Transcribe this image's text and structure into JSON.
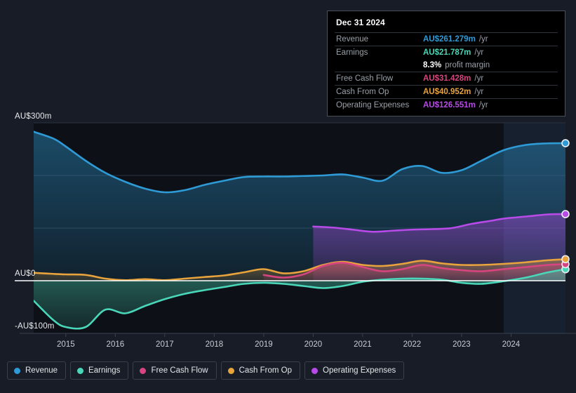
{
  "chart_data": {
    "type": "area",
    "title": "",
    "xlabel": "",
    "ylabel": "",
    "currency": "AU$",
    "ylim": [
      -100,
      300
    ],
    "xlim": [
      2014.35,
      2025.1
    ],
    "grid": true,
    "y_ticks": [
      {
        "value": 300,
        "label": "AU$300m"
      },
      {
        "value": 200,
        "label": ""
      },
      {
        "value": 100,
        "label": ""
      },
      {
        "value": 0,
        "label": "AU$0"
      },
      {
        "value": -100,
        "label": "-AU$100m"
      }
    ],
    "x_ticks": [
      2015,
      2016,
      2017,
      2018,
      2019,
      2020,
      2021,
      2022,
      2023,
      2024
    ],
    "x_tick_labels": [
      "2015",
      "2016",
      "2017",
      "2018",
      "2019",
      "2020",
      "2021",
      "2022",
      "2023",
      "2024"
    ],
    "forecast_band": {
      "start": 2023.85,
      "end": 2025.1,
      "label": ""
    },
    "legend_position": "bottom-left",
    "series": [
      {
        "name": "Revenue",
        "color": "#2e9bd6",
        "x": [
          2014.35,
          2014.75,
          2015.0,
          2015.4,
          2015.8,
          2016.2,
          2016.6,
          2017.0,
          2017.4,
          2017.8,
          2018.2,
          2018.6,
          2019.0,
          2019.4,
          2019.8,
          2020.2,
          2020.6,
          2021.0,
          2021.4,
          2021.8,
          2022.2,
          2022.6,
          2023.0,
          2023.4,
          2023.85,
          2024.3,
          2024.75,
          2025.1
        ],
        "values": [
          283,
          270,
          255,
          228,
          205,
          188,
          175,
          168,
          172,
          182,
          190,
          197,
          198,
          198,
          199,
          200,
          202,
          196,
          190,
          212,
          218,
          205,
          210,
          228,
          248,
          258,
          261,
          261.279
        ]
      },
      {
        "name": "Earnings",
        "color": "#4ad6b8",
        "x": [
          2014.35,
          2014.75,
          2015.0,
          2015.4,
          2015.8,
          2016.2,
          2016.6,
          2017.0,
          2017.4,
          2017.8,
          2018.2,
          2018.6,
          2019.0,
          2019.4,
          2019.8,
          2020.2,
          2020.6,
          2021.0,
          2021.4,
          2021.8,
          2022.2,
          2022.6,
          2023.0,
          2023.4,
          2023.85,
          2024.3,
          2024.75,
          2025.1
        ],
        "values": [
          -38,
          -75,
          -88,
          -88,
          -55,
          -62,
          -48,
          -35,
          -25,
          -18,
          -12,
          -6,
          -4,
          -6,
          -10,
          -14,
          -10,
          -2,
          2,
          4,
          4,
          2,
          -4,
          -6,
          -1,
          6,
          16,
          21.787
        ]
      },
      {
        "name": "Free Cash Flow",
        "color": "#d6457f",
        "x": [
          2019.0,
          2019.4,
          2019.8,
          2020.2,
          2020.6,
          2021.0,
          2021.4,
          2021.8,
          2022.2,
          2022.6,
          2023.0,
          2023.4,
          2023.85,
          2024.3,
          2024.75,
          2025.1
        ],
        "values": [
          11,
          6,
          12,
          28,
          34,
          26,
          18,
          22,
          30,
          24,
          20,
          18,
          22,
          26,
          30,
          31.428
        ]
      },
      {
        "name": "Cash From Op",
        "color": "#e8a33d",
        "x": [
          2014.35,
          2014.75,
          2015.0,
          2015.4,
          2015.8,
          2016.2,
          2016.6,
          2017.0,
          2017.4,
          2017.8,
          2018.2,
          2018.6,
          2019.0,
          2019.4,
          2019.8,
          2020.2,
          2020.6,
          2021.0,
          2021.4,
          2021.8,
          2022.2,
          2022.6,
          2023.0,
          2023.4,
          2023.85,
          2024.3,
          2024.75,
          2025.1
        ],
        "values": [
          15,
          13,
          12,
          11,
          4,
          1,
          3,
          1,
          4,
          7,
          10,
          16,
          22,
          14,
          18,
          30,
          36,
          30,
          28,
          32,
          38,
          33,
          30,
          30,
          32,
          35,
          39,
          40.952
        ]
      },
      {
        "name": "Operating Expenses",
        "color": "#b84ae8",
        "x": [
          2020.0,
          2020.4,
          2020.8,
          2021.2,
          2021.6,
          2022.0,
          2022.4,
          2022.8,
          2023.2,
          2023.6,
          2023.85,
          2024.3,
          2024.75,
          2025.1
        ],
        "values": [
          103,
          101,
          97,
          93,
          95,
          97,
          98,
          100,
          108,
          114,
          118,
          122,
          126,
          126.551
        ]
      }
    ]
  },
  "y_axis": {
    "top_label": "AU$300m",
    "zero_label": "AU$0",
    "bottom_label": "-AU$100m"
  },
  "tooltip": {
    "title": "Dec 31 2024",
    "rows": [
      {
        "label": "Revenue",
        "value": "AU$261.279m",
        "unit": "/yr",
        "color": "#2e9bd6"
      },
      {
        "label": "Earnings",
        "value": "AU$21.787m",
        "unit": "/yr",
        "color": "#4ad6b8"
      },
      {
        "label": "",
        "value": "8.3%",
        "unit": "profit margin",
        "color": "#ffffff"
      },
      {
        "label": "Free Cash Flow",
        "value": "AU$31.428m",
        "unit": "/yr",
        "color": "#d6457f"
      },
      {
        "label": "Cash From Op",
        "value": "AU$40.952m",
        "unit": "/yr",
        "color": "#e8a33d"
      },
      {
        "label": "Operating Expenses",
        "value": "AU$126.551m",
        "unit": "/yr",
        "color": "#b84ae8"
      }
    ]
  },
  "legend": {
    "items": [
      {
        "label": "Revenue",
        "color": "#2e9bd6"
      },
      {
        "label": "Earnings",
        "color": "#4ad6b8"
      },
      {
        "label": "Free Cash Flow",
        "color": "#d6457f"
      },
      {
        "label": "Cash From Op",
        "color": "#e8a33d"
      },
      {
        "label": "Operating Expenses",
        "color": "#b84ae8"
      }
    ]
  },
  "colors": {
    "page_background": "#171c26",
    "plot_background": "#0d1117",
    "gridline": "#2b3340",
    "zero_line": "#ffffff",
    "forecast_band": "#16202e"
  }
}
